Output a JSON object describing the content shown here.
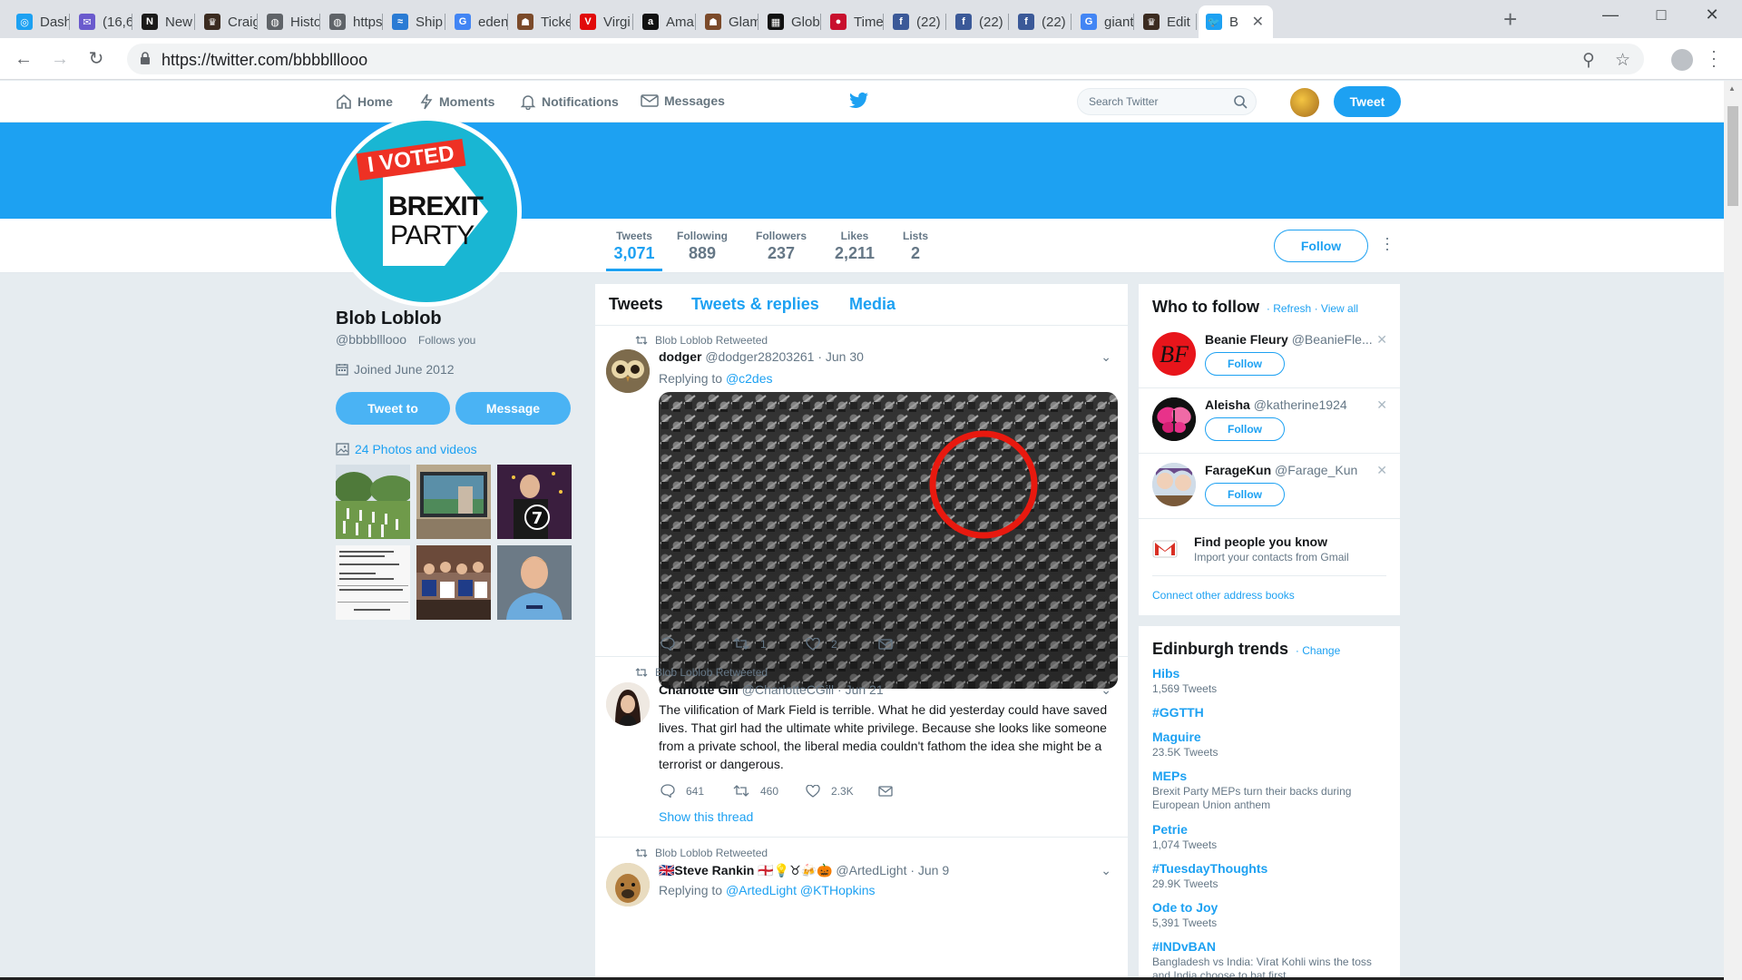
{
  "browser": {
    "tabs": [
      {
        "label": "Dash",
        "fav_color": "#1da1f2",
        "fav_glyph": "◎"
      },
      {
        "label": "(16,6",
        "fav_color": "#6a5acd",
        "fav_glyph": "✉"
      },
      {
        "label": "New",
        "fav_color": "#1a1a1a",
        "fav_glyph": "N"
      },
      {
        "label": "Craig",
        "fav_color": "#3b2b20",
        "fav_glyph": "♛"
      },
      {
        "label": "Histo",
        "fav_color": "#5f6368",
        "fav_glyph": "◍"
      },
      {
        "label": "https",
        "fav_color": "#5f6368",
        "fav_glyph": "◍"
      },
      {
        "label": "Ship",
        "fav_color": "#2a7bd4",
        "fav_glyph": "≈"
      },
      {
        "label": "eden",
        "fav_color": "#4285f4",
        "fav_glyph": "G"
      },
      {
        "label": "Ticke",
        "fav_color": "#7b4a2a",
        "fav_glyph": "☗"
      },
      {
        "label": "Virgi",
        "fav_color": "#e10a0a",
        "fav_glyph": "V"
      },
      {
        "label": "Ama",
        "fav_color": "#111111",
        "fav_glyph": "a"
      },
      {
        "label": "Glam",
        "fav_color": "#7b4a2a",
        "fav_glyph": "☗"
      },
      {
        "label": "Glob",
        "fav_color": "#111111",
        "fav_glyph": "▦"
      },
      {
        "label": "Time",
        "fav_color": "#c8102e",
        "fav_glyph": "●"
      },
      {
        "label": "(22)",
        "fav_color": "#3b5998",
        "fav_glyph": "f"
      },
      {
        "label": "(22)",
        "fav_color": "#3b5998",
        "fav_glyph": "f"
      },
      {
        "label": "(22)",
        "fav_color": "#3b5998",
        "fav_glyph": "f"
      },
      {
        "label": "giant",
        "fav_color": "#4285f4",
        "fav_glyph": "G"
      },
      {
        "label": "Edit",
        "fav_color": "#3b2b20",
        "fav_glyph": "♛"
      },
      {
        "label": "B",
        "fav_color": "#1da1f2",
        "fav_glyph": "🐦"
      }
    ],
    "url": "https://twitter.com/bbbblllooo"
  },
  "nav": {
    "home": "Home",
    "moments": "Moments",
    "notifications": "Notifications",
    "messages": "Messages",
    "search_placeholder": "Search Twitter",
    "tweet_button": "Tweet"
  },
  "stats": [
    {
      "label": "Tweets",
      "value": "3,071"
    },
    {
      "label": "Following",
      "value": "889"
    },
    {
      "label": "Followers",
      "value": "237"
    },
    {
      "label": "Likes",
      "value": "2,211"
    },
    {
      "label": "Lists",
      "value": "2"
    }
  ],
  "profile": {
    "follow_button": "Follow",
    "name": "Blob Loblob",
    "handle": "@bbbblllooo",
    "follows_you": "Follows you",
    "joined": "Joined June 2012",
    "tweet_to": "Tweet to",
    "message": "Message",
    "photos_link": "24 Photos and videos",
    "avatar_text": {
      "line1": "I VOTED",
      "line2": "BREXIT",
      "line3": "PARTY"
    }
  },
  "timeline": {
    "tabs": [
      "Tweets",
      "Tweets & replies",
      "Media"
    ],
    "tweets": [
      {
        "retweeted_by": "Blob Loblob Retweeted",
        "name": "dodger",
        "handle": "@dodger28203261 · Jun 30",
        "replying_prefix": "Replying to ",
        "replying_to": "@c2des",
        "reply_count": "",
        "retweet_count": "1",
        "like_count": "2"
      },
      {
        "retweeted_by": "Blob Loblob Retweeted",
        "name": "Charlotte Gill",
        "handle": "@CharlotteCGill · Jun 21",
        "text": "The vilification of Mark Field is terrible. What he did yesterday could have saved lives. That girl had the ultimate white privilege. Because she looks like someone from a private school, the liberal media couldn't fathom the idea she might be a terrorist or dangerous.",
        "reply_count": "641",
        "retweet_count": "460",
        "like_count": "2.3K",
        "show_thread": "Show this thread"
      },
      {
        "retweeted_by": "Blob Loblob Retweeted",
        "name": "🇬🇧Steve Rankin 🏴󠁧󠁢󠁥󠁮󠁧󠁿💡♉🍻🎃",
        "handle": "@ArtedLight · Jun 9",
        "replying_prefix": "Replying to ",
        "replying_to": "@ArtedLight @KTHopkins"
      }
    ]
  },
  "who_to_follow": {
    "title": "Who to follow",
    "refresh": "Refresh",
    "view_all": "View all",
    "dot": " · ",
    "items": [
      {
        "name": "Beanie Fleury",
        "handle": "@BeanieFle...",
        "follow": "Follow",
        "avatar_text": "BF"
      },
      {
        "name": "Aleisha",
        "handle": "@katherine1924",
        "follow": "Follow"
      },
      {
        "name": "FarageKun",
        "handle": "@Farage_Kun",
        "follow": "Follow"
      }
    ],
    "find_people_title": "Find people you know",
    "find_people_sub": "Import your contacts from Gmail",
    "connect": "Connect other address books"
  },
  "trends": {
    "title": "Edinburgh trends",
    "change": "Change",
    "items": [
      {
        "name": "Hibs",
        "count": "1,569 Tweets"
      },
      {
        "name": "#GGTTH",
        "count": ""
      },
      {
        "name": "Maguire",
        "count": "23.5K Tweets"
      },
      {
        "name": "MEPs",
        "count": "Brexit Party MEPs turn their backs during European Union anthem"
      },
      {
        "name": "Petrie",
        "count": "1,074 Tweets"
      },
      {
        "name": "#TuesdayThoughts",
        "count": "29.9K Tweets"
      },
      {
        "name": "Ode to Joy",
        "count": "5,391 Tweets"
      },
      {
        "name": "#INDvBAN",
        "count": "Bangladesh vs India: Virat Kohli wins the toss and India choose to bat first"
      }
    ]
  },
  "colors": {
    "twitter_blue": "#1da1f2",
    "banner": "#1da1f2",
    "background": "#e6ecf0"
  }
}
